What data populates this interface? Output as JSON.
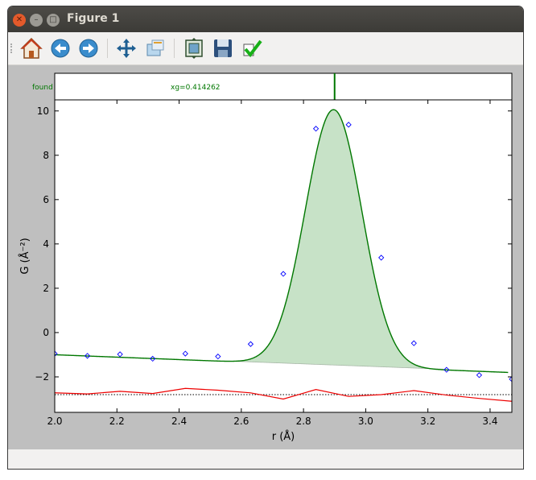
{
  "window": {
    "title": "Figure 1"
  },
  "toolbar": {
    "items": [
      "home-icon",
      "back-arrow-icon",
      "forward-arrow-icon",
      "pan-move-icon",
      "zoom-icon",
      "subplots-config-icon",
      "save-disk-icon",
      "checkmark-icon"
    ]
  },
  "top_strip": {
    "label": "found",
    "annotation": "xg=0.414262"
  },
  "colors": {
    "fit": "#007700",
    "fill": "#c7e2c7",
    "points": "#0000ff",
    "residual": "#ee0000"
  },
  "chart_data": {
    "type": "line",
    "xlabel": "r (Å)",
    "ylabel": "G (Å⁻²)",
    "xlim": [
      2.0,
      3.47
    ],
    "ylim": [
      -3.6,
      10.5
    ],
    "xticks": [
      "2.0",
      "2.2",
      "2.4",
      "2.6",
      "2.8",
      "3.0",
      "3.2",
      "3.4"
    ],
    "yticks": [
      "−2",
      "0",
      "2",
      "4",
      "6",
      "8",
      "10"
    ],
    "series": [
      {
        "kind": "data-points",
        "x": [
          2.0,
          2.105,
          2.21,
          2.315,
          2.42,
          2.525,
          2.63,
          2.735,
          2.84,
          2.945,
          3.05,
          3.155,
          3.26,
          3.365,
          3.47
        ],
        "y": [
          -0.95,
          -1.05,
          -0.98,
          -1.18,
          -0.95,
          -1.08,
          -0.52,
          2.65,
          9.2,
          9.38,
          3.38,
          -0.48,
          -1.68,
          -1.92,
          -2.1
        ]
      },
      {
        "kind": "fit",
        "baseline": {
          "x": [
            2.0,
            3.46
          ],
          "y": [
            -1.0,
            -1.8
          ]
        },
        "peak": {
          "center": 2.897,
          "height": 11.55,
          "sigma": 0.091
        },
        "fill_baseline": {
          "x": [
            2.55,
            3.25
          ],
          "y": [
            -1.28,
            -1.65
          ]
        }
      },
      {
        "kind": "residual",
        "x": [
          2.0,
          2.105,
          2.21,
          2.315,
          2.42,
          2.525,
          2.63,
          2.735,
          2.84,
          2.945,
          3.05,
          3.155,
          3.26,
          3.365,
          3.47
        ],
        "y": [
          -2.72,
          -2.77,
          -2.65,
          -2.75,
          -2.52,
          -2.6,
          -2.72,
          -3.0,
          -2.57,
          -2.88,
          -2.8,
          -2.62,
          -2.82,
          -2.97,
          -3.1
        ]
      },
      {
        "kind": "zero-line",
        "y": -2.8
      }
    ],
    "marker_x": 2.9
  }
}
